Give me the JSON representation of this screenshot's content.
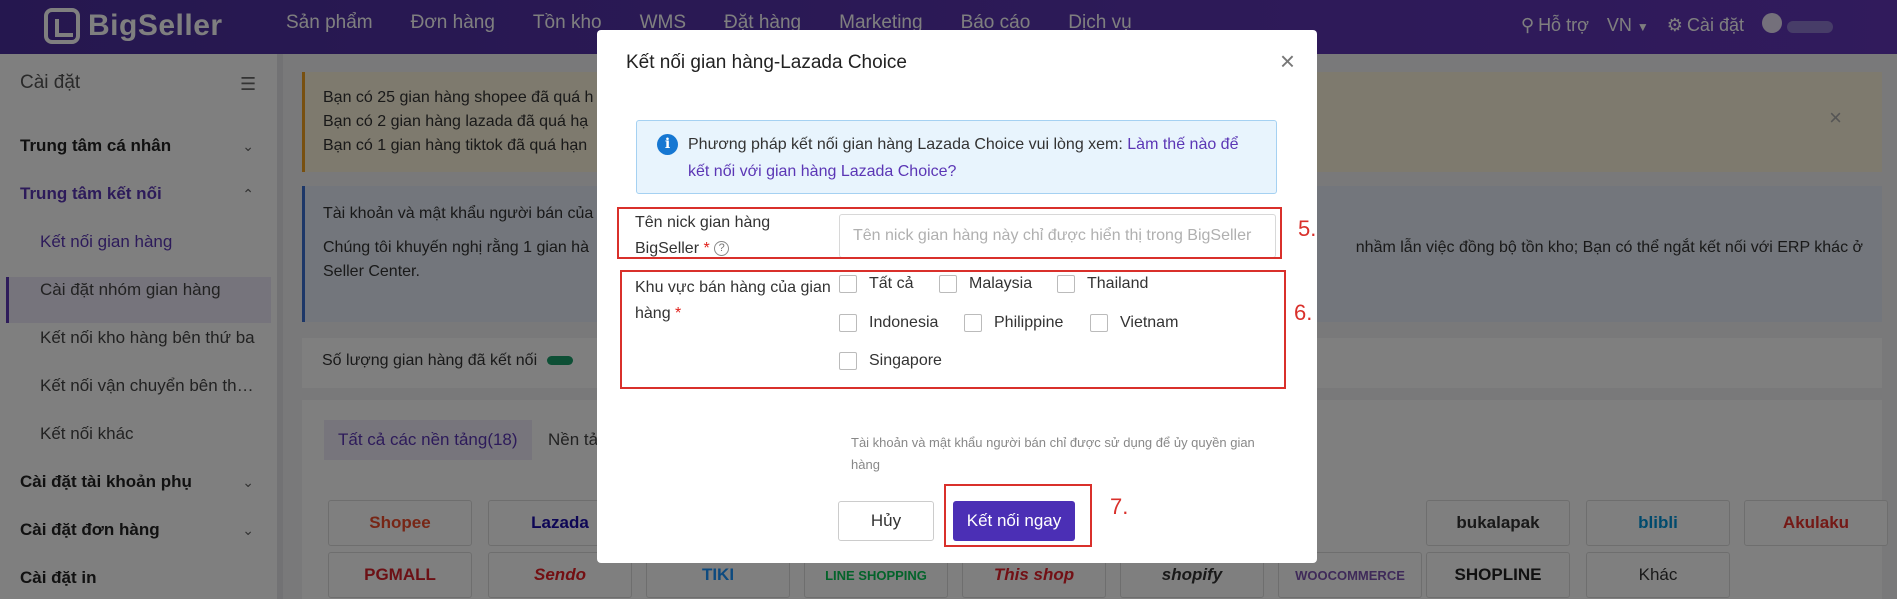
{
  "topbar": {
    "logo_text": "BigSeller",
    "nav": [
      "Sản phẩm",
      "Đơn hàng",
      "Tồn kho",
      "WMS",
      "Đặt hàng",
      "Marketing",
      "Báo cáo",
      "Dịch vụ"
    ],
    "support": "Hỗ trợ",
    "language": "VN",
    "settings": "Cài đặt",
    "icons": {
      "support": "search-icon",
      "settings": "gear-icon",
      "user": "user-icon",
      "language": "chevron-down-icon"
    }
  },
  "sidebar": {
    "title": "Cài đặt",
    "groups": [
      {
        "label": "Trung tâm cá nhân"
      },
      {
        "label": "Trung tâm kết nối",
        "active": true
      }
    ],
    "subitems": [
      "Kết nối gian hàng",
      "Cài đặt nhóm gian hàng",
      "Kết nối kho hàng bên thứ ba",
      "Kết nối vận chuyển bên thứ...",
      "Kết nối khác"
    ],
    "more_groups": [
      "Cài đặt tài khoản phụ",
      "Cài đặt đơn hàng",
      "Cài đặt in"
    ]
  },
  "main": {
    "alert_lines": [
      "Bạn có 25 gian hàng shopee đã quá h",
      "Bạn có 2 gian hàng lazada đã quá hạ",
      "Bạn có 1 gian hàng tiktok đã quá hạn"
    ],
    "info_line1": "Tài khoản và mật khẩu người bán của",
    "info_line2a": "Chúng tôi khuyến nghị rằng 1 gian hà",
    "info_line2b": "nhầm lẫn việc đồng bộ tồn kho; Bạn có thể ngắt kết nối với ERP khác ở",
    "info_line3": "Seller Center.",
    "stat_label": "Số lượng gian hàng đã kết nối",
    "tab_all": "Tất cả các nền tảng(18)",
    "tab_next": "Nền tản",
    "platforms_row1": [
      "Shopee",
      "Lazada",
      "bukalapak",
      "blibli",
      "Akulaku"
    ],
    "platforms_row2": [
      "PGMALL",
      "Sendo",
      "TIKI",
      "LINE SHOPPING",
      "This shop",
      "shopify",
      "WOOCOMMERCE",
      "SHOPLINE",
      "Khác"
    ]
  },
  "modal": {
    "title": "Kết nối gian hàng-Lazada Choice",
    "info_text": "Phương pháp kết nối gian hàng Lazada Choice vui lòng xem: ",
    "info_link": "Làm thế nào để kết nối với gian hàng Lazada Choice?",
    "nick_label_1": "Tên nick gian hàng",
    "nick_label_2": "BigSeller",
    "nick_placeholder": "Tên nick gian hàng này chỉ được hiển thị trong BigSeller",
    "region_label_1": "Khu vực bán hàng của gian",
    "region_label_2": "hàng",
    "regions": [
      "Tất cả",
      "Malaysia",
      "Thailand",
      "Indonesia",
      "Philippine",
      "Vietnam",
      "Singapore"
    ],
    "hint": "Tài khoản và mật khẩu người bán chỉ được sử dụng để ủy quyền gian hàng",
    "cancel": "Hủy",
    "connect": "Kết nối ngay",
    "required_mark": "*",
    "help_mark": "?",
    "close_mark": "×"
  },
  "annotations": {
    "step5": "5.",
    "step6": "6.",
    "step7": "7."
  },
  "colors": {
    "brand": "#4b2fb5",
    "annotation": "#d9302b",
    "info": "#1677d2"
  }
}
